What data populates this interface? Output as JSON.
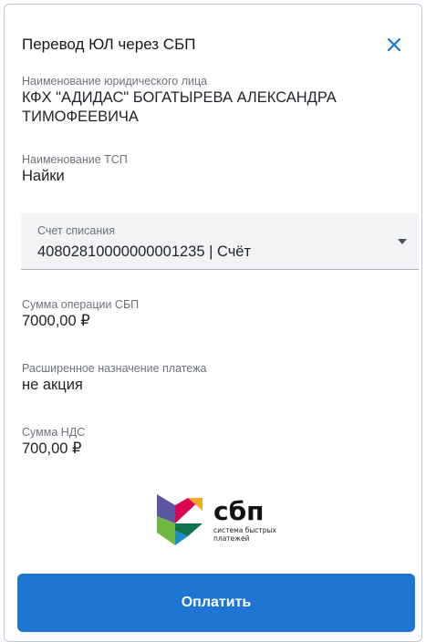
{
  "dialog": {
    "title": "Перевод ЮЛ через СБП",
    "close_icon": "close-icon"
  },
  "fields": {
    "legal_name_label": "Наименование юридического лица",
    "legal_name_line1": "КФХ \"АДИДАС\" БОГАТЫРЕВА АЛЕКСАНДРА",
    "legal_name_line2": "ТИМОФЕЕВИЧА",
    "tsp_label": "Наименование ТСП",
    "tsp_value": "Найки",
    "account_label": "Счет списания",
    "account_value": "40802810000000001235 | Счёт",
    "amount_label": "Сумма операции СБП",
    "amount_value": "7000,00 ₽",
    "purpose_label": "Расширенное назначение платежа",
    "purpose_value": "не акция",
    "vat_label": "Сумма НДС",
    "vat_value": "700,00 ₽"
  },
  "logo": {
    "brand": "сбп",
    "tagline_line1": "система быстрых",
    "tagline_line2": "платежей"
  },
  "actions": {
    "pay_label": "Оплатить"
  },
  "colors": {
    "accent": "#1e75d2",
    "close": "#1e75d2"
  }
}
